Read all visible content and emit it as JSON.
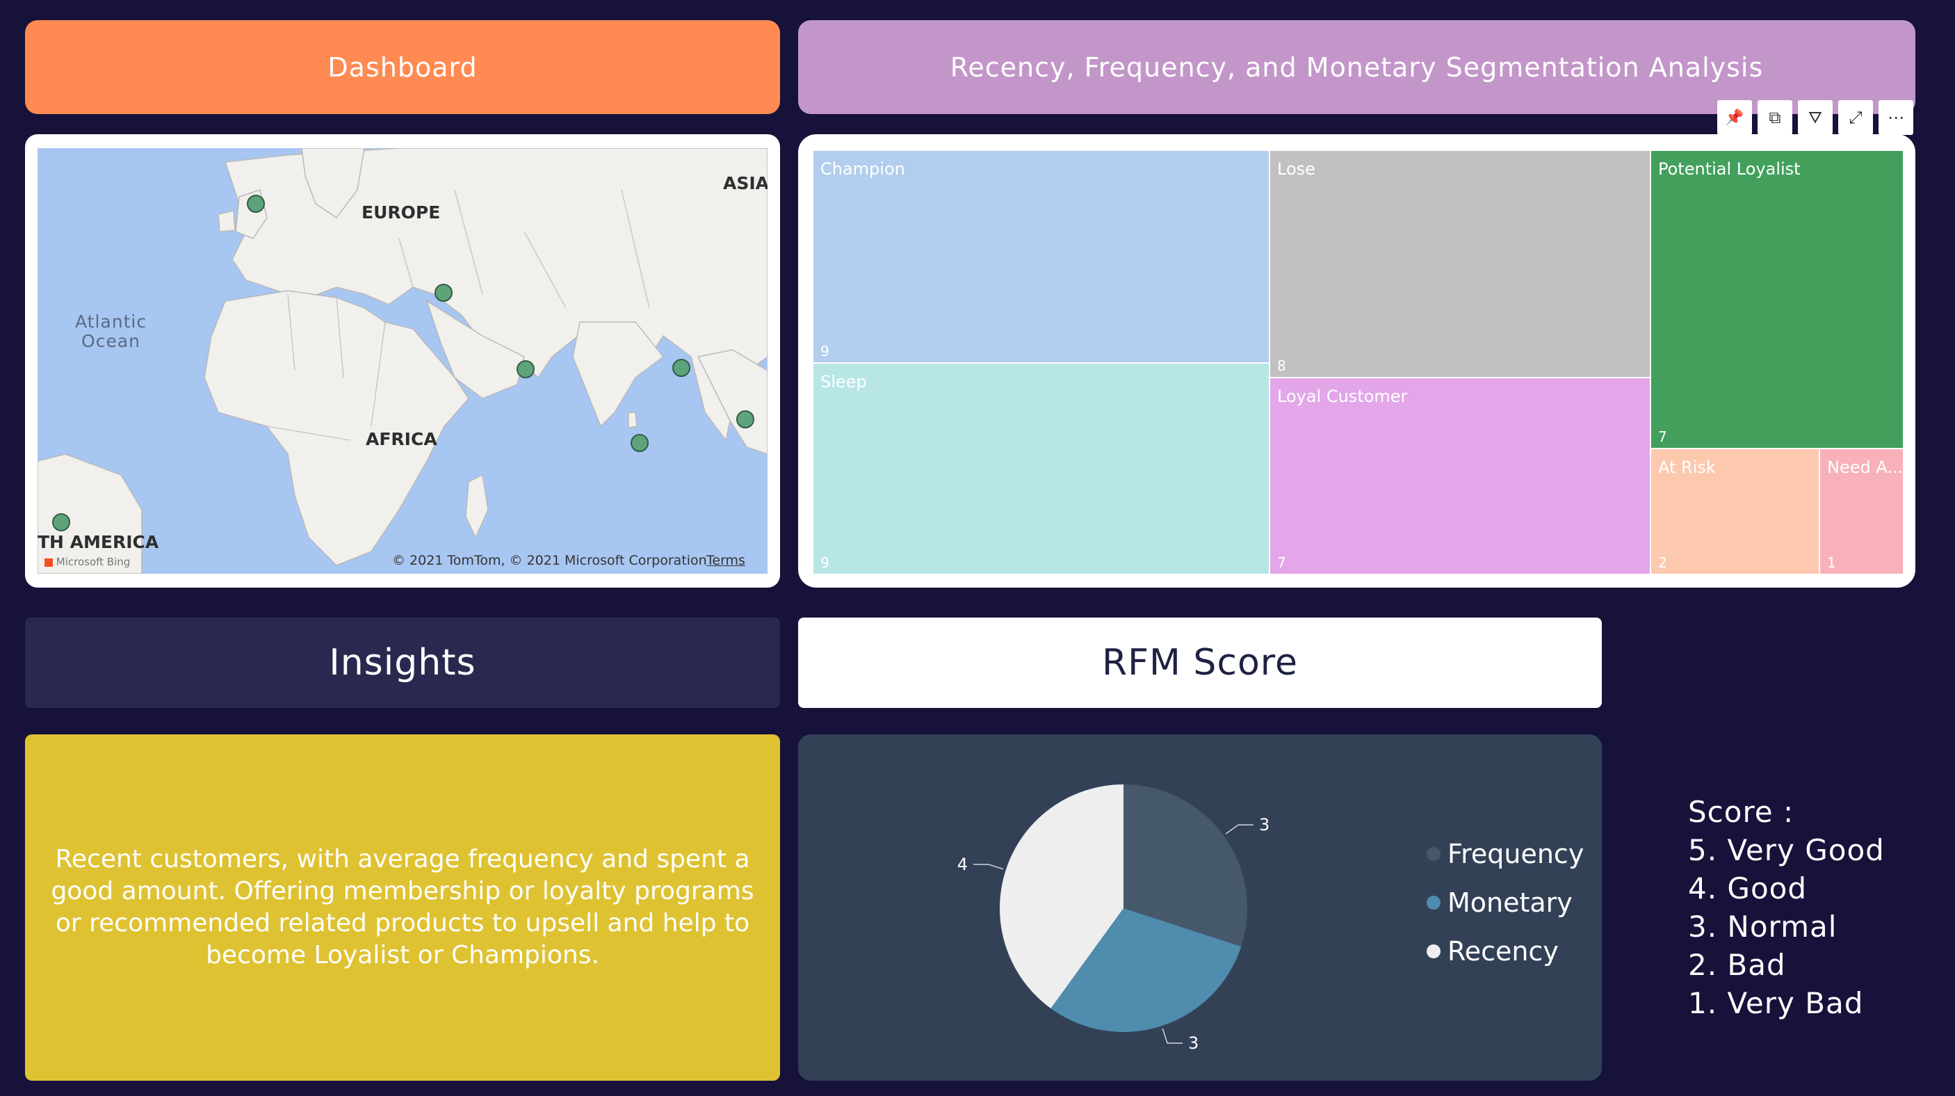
{
  "header": {
    "dashboard": "Dashboard",
    "rfm_title": "Recency, Frequency, and Monetary Segmentation Analysis"
  },
  "map": {
    "labels": {
      "europe": "EUROPE",
      "asia": "ASIA",
      "africa": "AFRICA",
      "south_america": "TH AMERICA",
      "atlantic_line1": "Atlantic",
      "atlantic_line2": "Ocean"
    },
    "attribution": "© 2021 TomTom, © 2021 Microsoft Corporation",
    "terms": "Terms",
    "bing": "Microsoft Bing",
    "marker_color": "#5fa37a"
  },
  "toolbar": {
    "icons": [
      "pin-icon",
      "copy-icon",
      "filter-icon",
      "expand-icon",
      "more-options-icon"
    ],
    "glyphs": [
      "📌",
      "⧉",
      "⛛",
      "⤢",
      "⋯"
    ]
  },
  "treemap": {
    "segments": [
      {
        "label": "Champion",
        "value": "9",
        "color": "#b3cdee"
      },
      {
        "label": "Sleep",
        "value": "9",
        "color": "#b8e6e6"
      },
      {
        "label": "Lose",
        "value": "8",
        "color": "#c1c1c1"
      },
      {
        "label": "Loyal Customer",
        "value": "7",
        "color": "#e2a6e9"
      },
      {
        "label": "Potential Loyalist",
        "value": "7",
        "color": "#43a05c"
      },
      {
        "label": "At Risk",
        "value": "2",
        "color": "#fcc9af"
      },
      {
        "label": "Need A...",
        "value": "1",
        "color": "#f8b1b8"
      }
    ]
  },
  "insights": {
    "title": "Insights",
    "text": "Recent customers, with average frequency and spent a good amount. Offering membership or loyalty programs or recommended related products to upsell and help to become Loyalist or Champions."
  },
  "rfm_score": {
    "title": "RFM Score"
  },
  "chart_data": {
    "type": "pie",
    "title": "",
    "slices": [
      {
        "label": "Frequency",
        "value": 3,
        "color": "#46596b"
      },
      {
        "label": "Monetary",
        "value": 3,
        "color": "#4f8cae"
      },
      {
        "label": "Recency",
        "value": 4,
        "color": "#eeeeee"
      }
    ],
    "legend_position": "right"
  },
  "score_legend": {
    "title": "Score :",
    "items": [
      "5. Very Good",
      "4. Good",
      "3. Normal",
      "2. Bad",
      "1. Very Bad"
    ]
  }
}
